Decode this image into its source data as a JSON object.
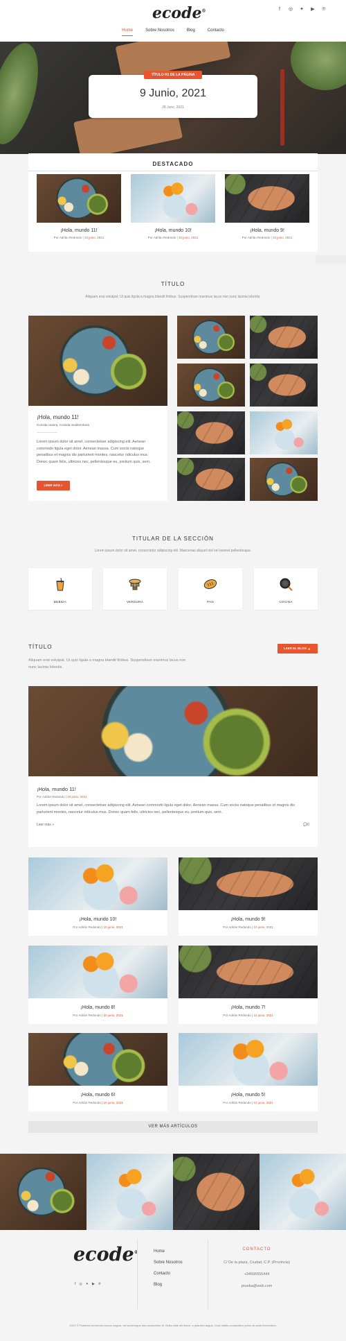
{
  "brand": {
    "logo": "ecode",
    "trademark": "®"
  },
  "social_icons": [
    "facebook-icon",
    "instagram-icon",
    "twitter-icon",
    "youtube-icon",
    "pinterest-icon"
  ],
  "nav": [
    {
      "label": "Home",
      "active": true
    },
    {
      "label": "Sobre Nosotros",
      "active": false
    },
    {
      "label": "Blog",
      "active": false
    },
    {
      "label": "Contacto",
      "active": false
    }
  ],
  "hero": {
    "badge": "TÍTULO H1 DE LA PÁGINA",
    "title": "9 Junio, 2021",
    "date": "28 June, 2021"
  },
  "featured": {
    "heading": "DESTACADO",
    "posts": [
      {
        "title": "¡Hola, mundo 11!",
        "author": "Por Adrián Redondo",
        "date": "10 junio, 2021"
      },
      {
        "title": "¡Hola, mundo 10!",
        "author": "Por Adrián Redondo",
        "date": "10 junio, 2021"
      },
      {
        "title": "¡Hola, mundo 9!",
        "author": "Por Adrián Redondo",
        "date": "10 junio, 2021"
      }
    ]
  },
  "section1": {
    "title": "TÍTULO",
    "subtitle": "Aliquam erat volutpat. Ut quis ligula a magna blandit finibus. Suspendisse maximus lacus non nunc lacinia lobortis.",
    "post": {
      "title": "¡Hola, mundo 11!",
      "categories": "Comida casera, Comida mediterránea",
      "excerpt": "Lorem ipsum dolor sit amet, consectetuer adipiscing elit. Aenean commodo ligula eget dolor. Aenean massa. Cum sociis natoque penatibus et magnis dis parturient montes, nascetur ridiculus mus. Donec quam felis, ultricies nec, pellentesque eu, pretium quis, sem.",
      "button": "LEER MÁS »"
    }
  },
  "section2": {
    "title": "TITULAR DE LA SECCIÓN",
    "subtitle": "Lorem ipsum dolor sit amet, consectetur adipiscing elit. Maecenas aliquet nisl vel laoreet pellentesque.",
    "categories": [
      {
        "label": "BEBIDA",
        "icon": "drink-icon"
      },
      {
        "label": "VERDURA",
        "icon": "vegetable-icon"
      },
      {
        "label": "PAN",
        "icon": "bread-icon"
      },
      {
        "label": "COCINA",
        "icon": "pan-icon"
      }
    ]
  },
  "section3": {
    "title": "TÍTULO",
    "subtitle": "Aliquam erat volutpat. Ut quis ligula a magna blandit finibus. Suspendisse maximus lacus non nunc lacinia lobortis.",
    "blog_button": "LEER EL BLOG",
    "main_post": {
      "title": "¡Hola, mundo 11!",
      "author": "Por Adrián Redondo",
      "date": "10 junio, 2021",
      "excerpt": "Lorem ipsum dolor sit amet, consectetuer adipiscing elit. Aenean commodo ligula eget dolor. Aenean massa. Cum sociis natoque penatibus et magnis dis parturient montes, nascetur ridiculus mus. Donec quam felis, ultricies nec, pellentesque eu, pretium quis, sem.",
      "read_more": "Leer más »",
      "comments": "0"
    },
    "posts": [
      {
        "title": "¡Hola, mundo 10!",
        "author": "Por Adrián Redondo",
        "date": "10 junio, 2021"
      },
      {
        "title": "¡Hola, mundo 9!",
        "author": "Por Adrián Redondo",
        "date": "10 junio, 2021"
      },
      {
        "title": "¡Hola, mundo 8!",
        "author": "Por Adrián Redondo",
        "date": "10 junio, 2021"
      },
      {
        "title": "¡Hola, mundo 7!",
        "author": "Por Adrián Redondo",
        "date": "10 junio, 2021"
      },
      {
        "title": "¡Hola, mundo 6!",
        "author": "Por Adrián Redondo",
        "date": "10 junio, 2021"
      },
      {
        "title": "¡Hola, mundo 5!",
        "author": "Por Adrián Redondo",
        "date": "10 junio, 2021"
      }
    ],
    "more_button": "VER MÁS ARTÍCULOS"
  },
  "footer": {
    "logo": "ecode",
    "links": [
      "Home",
      "Sobre Nosotros",
      "Contacto",
      "Blog"
    ],
    "contact_heading": "CONTACTO",
    "address": "C/ De la plaza, Ciudad, C.P. (Provincia)",
    "phone": "+34666555444",
    "email": "prueba@web.com",
    "copyright": "2021 © Powered commodo cursus magna, vel scelerisque nisl consectetur et. Nulla vitae elit libero, a pharetra augue. Cras mattis consectetur purus sit amet fermentum."
  },
  "colors": {
    "accent": "#e8542e",
    "background": "#f4f4f4",
    "text": "#333333"
  }
}
